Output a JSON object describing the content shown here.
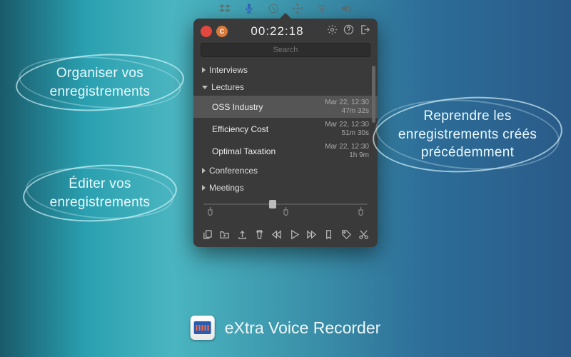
{
  "menubar_icons": [
    "dropbox-icon",
    "microphone-icon",
    "clock-icon",
    "move-icon",
    "wifi-icon",
    "volume-icon"
  ],
  "timer": "00:22:18",
  "search_placeholder": "Search",
  "groups": [
    {
      "name": "Interviews",
      "expanded": false,
      "items": []
    },
    {
      "name": "Lectures",
      "expanded": true,
      "items": [
        {
          "name": "OSS Industry",
          "date": "Mar 22, 12:30",
          "duration": "47m 32s",
          "selected": true
        },
        {
          "name": "Efficiency Cost",
          "date": "Mar 22, 12:30",
          "duration": "51m 30s",
          "selected": false
        },
        {
          "name": "Optimal Taxation",
          "date": "Mar 22, 12:30",
          "duration": "1h 9m",
          "selected": false
        }
      ]
    },
    {
      "name": "Conferences",
      "expanded": false,
      "items": []
    },
    {
      "name": "Meetings",
      "expanded": false,
      "items": []
    }
  ],
  "slider_pos_percent": 42,
  "callouts": {
    "organize": "Organiser vos enregistrements",
    "edit": "Éditer vos enregistrements",
    "resume": "Reprendre les enregistrements créés précédemment"
  },
  "app_title": "eXtra Voice Recorder",
  "continue_badge": "C"
}
